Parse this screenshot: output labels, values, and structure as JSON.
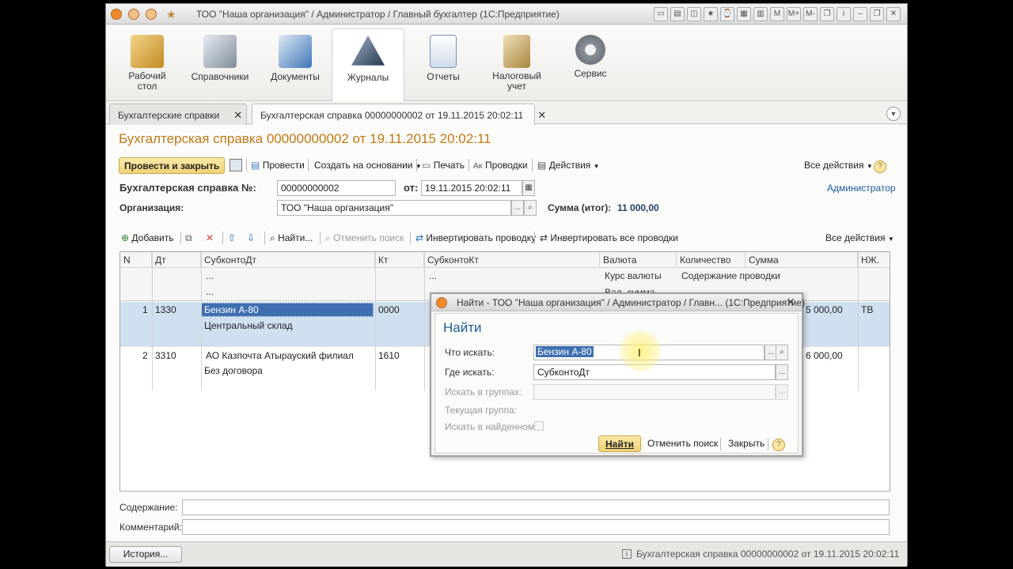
{
  "window": {
    "title": "ТОО \"Наша организация\" / Администратор / Главный бухгалтер  (1С:Предприятие)",
    "title_icons": [
      "M",
      "M+",
      "M-"
    ]
  },
  "sections": [
    {
      "label": "Рабочий стол",
      "icon": "desk-lamp-icon",
      "color": "#d8a23a"
    },
    {
      "label": "Справочники",
      "icon": "keyboard-icon",
      "color": "#8b98a8"
    },
    {
      "label": "Документы",
      "icon": "documents-pen-icon",
      "color": "#4f86c6"
    },
    {
      "label": "Журналы",
      "icon": "journal-pyramid-icon",
      "color": "#3c4f6a"
    },
    {
      "label": "Отчеты",
      "icon": "report-chart-icon",
      "color": "#6f8fb8"
    },
    {
      "label": "Налоговый учет",
      "icon": "tax-book-icon",
      "color": "#c9a76a"
    },
    {
      "label": "Сервис",
      "icon": "gear-icon",
      "color": "#7a7f86"
    }
  ],
  "tabs": [
    {
      "label": "Бухгалтерские справки"
    },
    {
      "label": "Бухгалтерская справка 00000000002 от 19.11.2015 20:02:11"
    }
  ],
  "doc": {
    "title": "Бухгалтерская справка 00000000002 от 19.11.2015 20:02:11",
    "toolbar": {
      "post_close": "Провести и закрыть",
      "post": "Провести",
      "create_based": "Создать на основании",
      "print": "Печать",
      "entries": "Проводки",
      "actions": "Действия",
      "all_actions": "Все действия"
    },
    "number_label": "Бухгалтерская справка №:",
    "number_value": "00000000002",
    "date_label": "от:",
    "date_value": "19.11.2015 20:02:11",
    "user_link": "Администратор",
    "org_label": "Организация:",
    "org_value": "ТОО \"Наша организация\"",
    "sum_label": "Сумма (итог):",
    "sum_value": "11 000,00"
  },
  "grid_toolbar": {
    "add": "Добавить",
    "find": "Найти...",
    "cancel_search": "Отменить поиск",
    "invert_entry": "Инвертировать проводку",
    "invert_all": "Инвертировать все проводки",
    "all_actions": "Все действия"
  },
  "grid": {
    "headers": {
      "n": "N",
      "dt": "Дт",
      "subkonto_dt": "СубконтоДт",
      "kt": "Кт",
      "subkonto_kt": "СубконтоКт",
      "currency": "Валюта",
      "quantity": "Количество",
      "sum": "Сумма",
      "nzh": "НЖ."
    },
    "sub_headers": {
      "dots1": "...",
      "dots2": "...",
      "dots3": "...",
      "rate": "Курс валюты",
      "val_sum": "Вал. сумма",
      "content": "Содержание проводки"
    },
    "rows": [
      {
        "n": "1",
        "dt": "1330",
        "sub_dt_1": "Бензин А-80",
        "sub_dt_2": "Центральный склад",
        "kt": "0000",
        "sum": "5 000,00",
        "nzh": "ТВ"
      },
      {
        "n": "2",
        "dt": "3310",
        "sub_dt_1": "АО Казпочта Атырауский филиал",
        "sub_dt_2": "Без договора",
        "kt": "1610",
        "sum": "6 000,00",
        "nzh": ""
      }
    ]
  },
  "footer_fields": {
    "content_label": "Содержание:",
    "comment_label": "Комментарий:"
  },
  "statusbar": {
    "history": "История...",
    "message": "Бухгалтерская справка 00000000002 от 19.11.2015 20:02:11"
  },
  "find_dialog": {
    "title": "Найти - ТОО \"Наша организация\" / Администратор / Главн...  (1С:Предприятие)",
    "heading": "Найти",
    "what_label": "Что искать:",
    "what_value": "Бензин А-80",
    "where_label": "Где искать:",
    "where_value": "СубконтоДт",
    "in_groups_label": "Искать в группах:",
    "current_group_label": "Текущая группа:",
    "in_found_label": "Искать в найденном:",
    "find_btn": "Найти",
    "cancel_btn": "Отменить поиск",
    "close_btn": "Закрыть",
    "help": "?"
  },
  "colors": {
    "accent_orange": "#c07a14",
    "dialog_heading": "#1f5f95",
    "link": "#1c5a9a",
    "selection": "#cfe0f0"
  }
}
